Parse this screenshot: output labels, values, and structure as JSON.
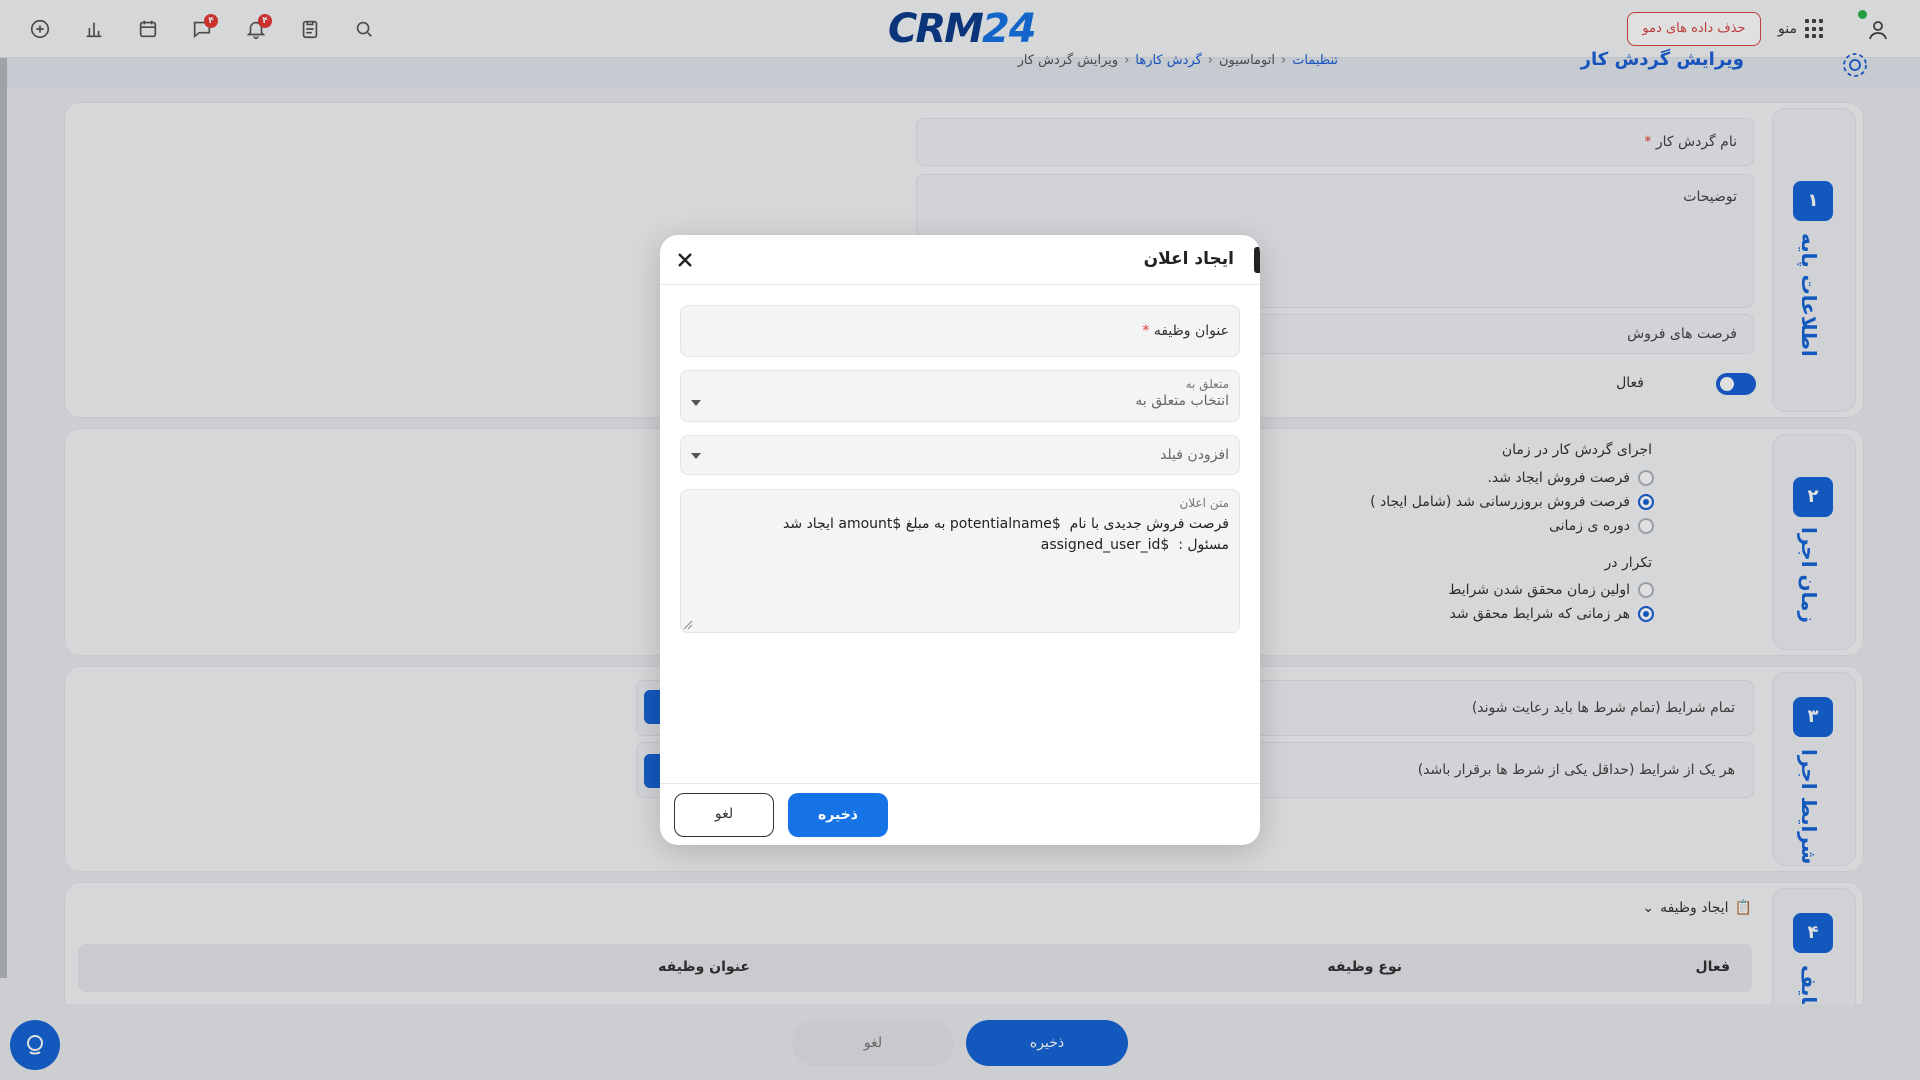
{
  "topbar": {
    "icons": [
      "add-circle-icon",
      "bar-chart-icon",
      "calendar-icon",
      "chat-icon",
      "bell-icon",
      "clipboard-icon",
      "search-icon"
    ],
    "chat_badge": "۴",
    "bell_badge": "۴",
    "logo_crm": "CRM",
    "logo_num": "24",
    "demo_button": "حذف داده های دمو",
    "menu_label": "منو"
  },
  "page": {
    "title": "ویرایش گردش کار",
    "breadcrumb": [
      "تنظیمات",
      "اتوماسیون",
      "گردش کارها",
      "ویرایش گردش کار"
    ]
  },
  "steps": [
    {
      "number": "۱",
      "label": "اطلاعات پایه"
    },
    {
      "number": "۲",
      "label": "زمان اجرا"
    },
    {
      "number": "۳",
      "label": "شرایط اجرا"
    },
    {
      "number": "۴",
      "label": "وظایف"
    }
  ],
  "basic": {
    "name_label": "نام گردش کار",
    "description_label": "توضیحات",
    "module_value": "فرصت های فروش",
    "active_label": "فعال"
  },
  "trigger": {
    "heading": "اجرای گردش کار در زمان",
    "options": [
      {
        "label": "فرصت فروش ایجاد شد.",
        "checked": false
      },
      {
        "label": "فرصت فروش بروزرسانی شد (شامل ایجاد )",
        "checked": true
      },
      {
        "label": "دوره ی زمانی",
        "checked": false
      }
    ],
    "repeat_heading": "تکرار در",
    "repeat_options": [
      {
        "label": "اولین زمان محقق شدن شرایط",
        "checked": false
      },
      {
        "label": "هر زمانی که شرایط محقق شد",
        "checked": true
      }
    ]
  },
  "conditions": {
    "all": "تمام شرایط (تمام شرط ها باید رعایت شوند)",
    "any": "هر یک از شرایط (حداقل یکی از شرط ها برقرار باشد)"
  },
  "tasks": {
    "create_task": "ایجاد وظیفه",
    "columns": {
      "active": "فعال",
      "type": "نوع وظیفه",
      "title": "عنوان وظیفه"
    }
  },
  "bottom": {
    "save": "ذخیره",
    "cancel": "لغو"
  },
  "modal": {
    "title": "ایجاد اعلان",
    "task_title_label": "عنوان وظیفه",
    "related_label": "متعلق به",
    "related_placeholder": "انتخاب متعلق به",
    "add_field_placeholder": "افزودن فیلد",
    "message_label": "متن اعلان",
    "message_line1": "فرصت فروش جدیدی با نام  $potentialname به مبلغ $amount ایجاد شد",
    "message_line2": "مسئول :  $assigned_user_id",
    "save": "ذخیره",
    "cancel": "لغو"
  },
  "colors": {
    "primary": "#1565d8",
    "brand_dark": "#0c3d8c",
    "danger": "#d64545"
  }
}
